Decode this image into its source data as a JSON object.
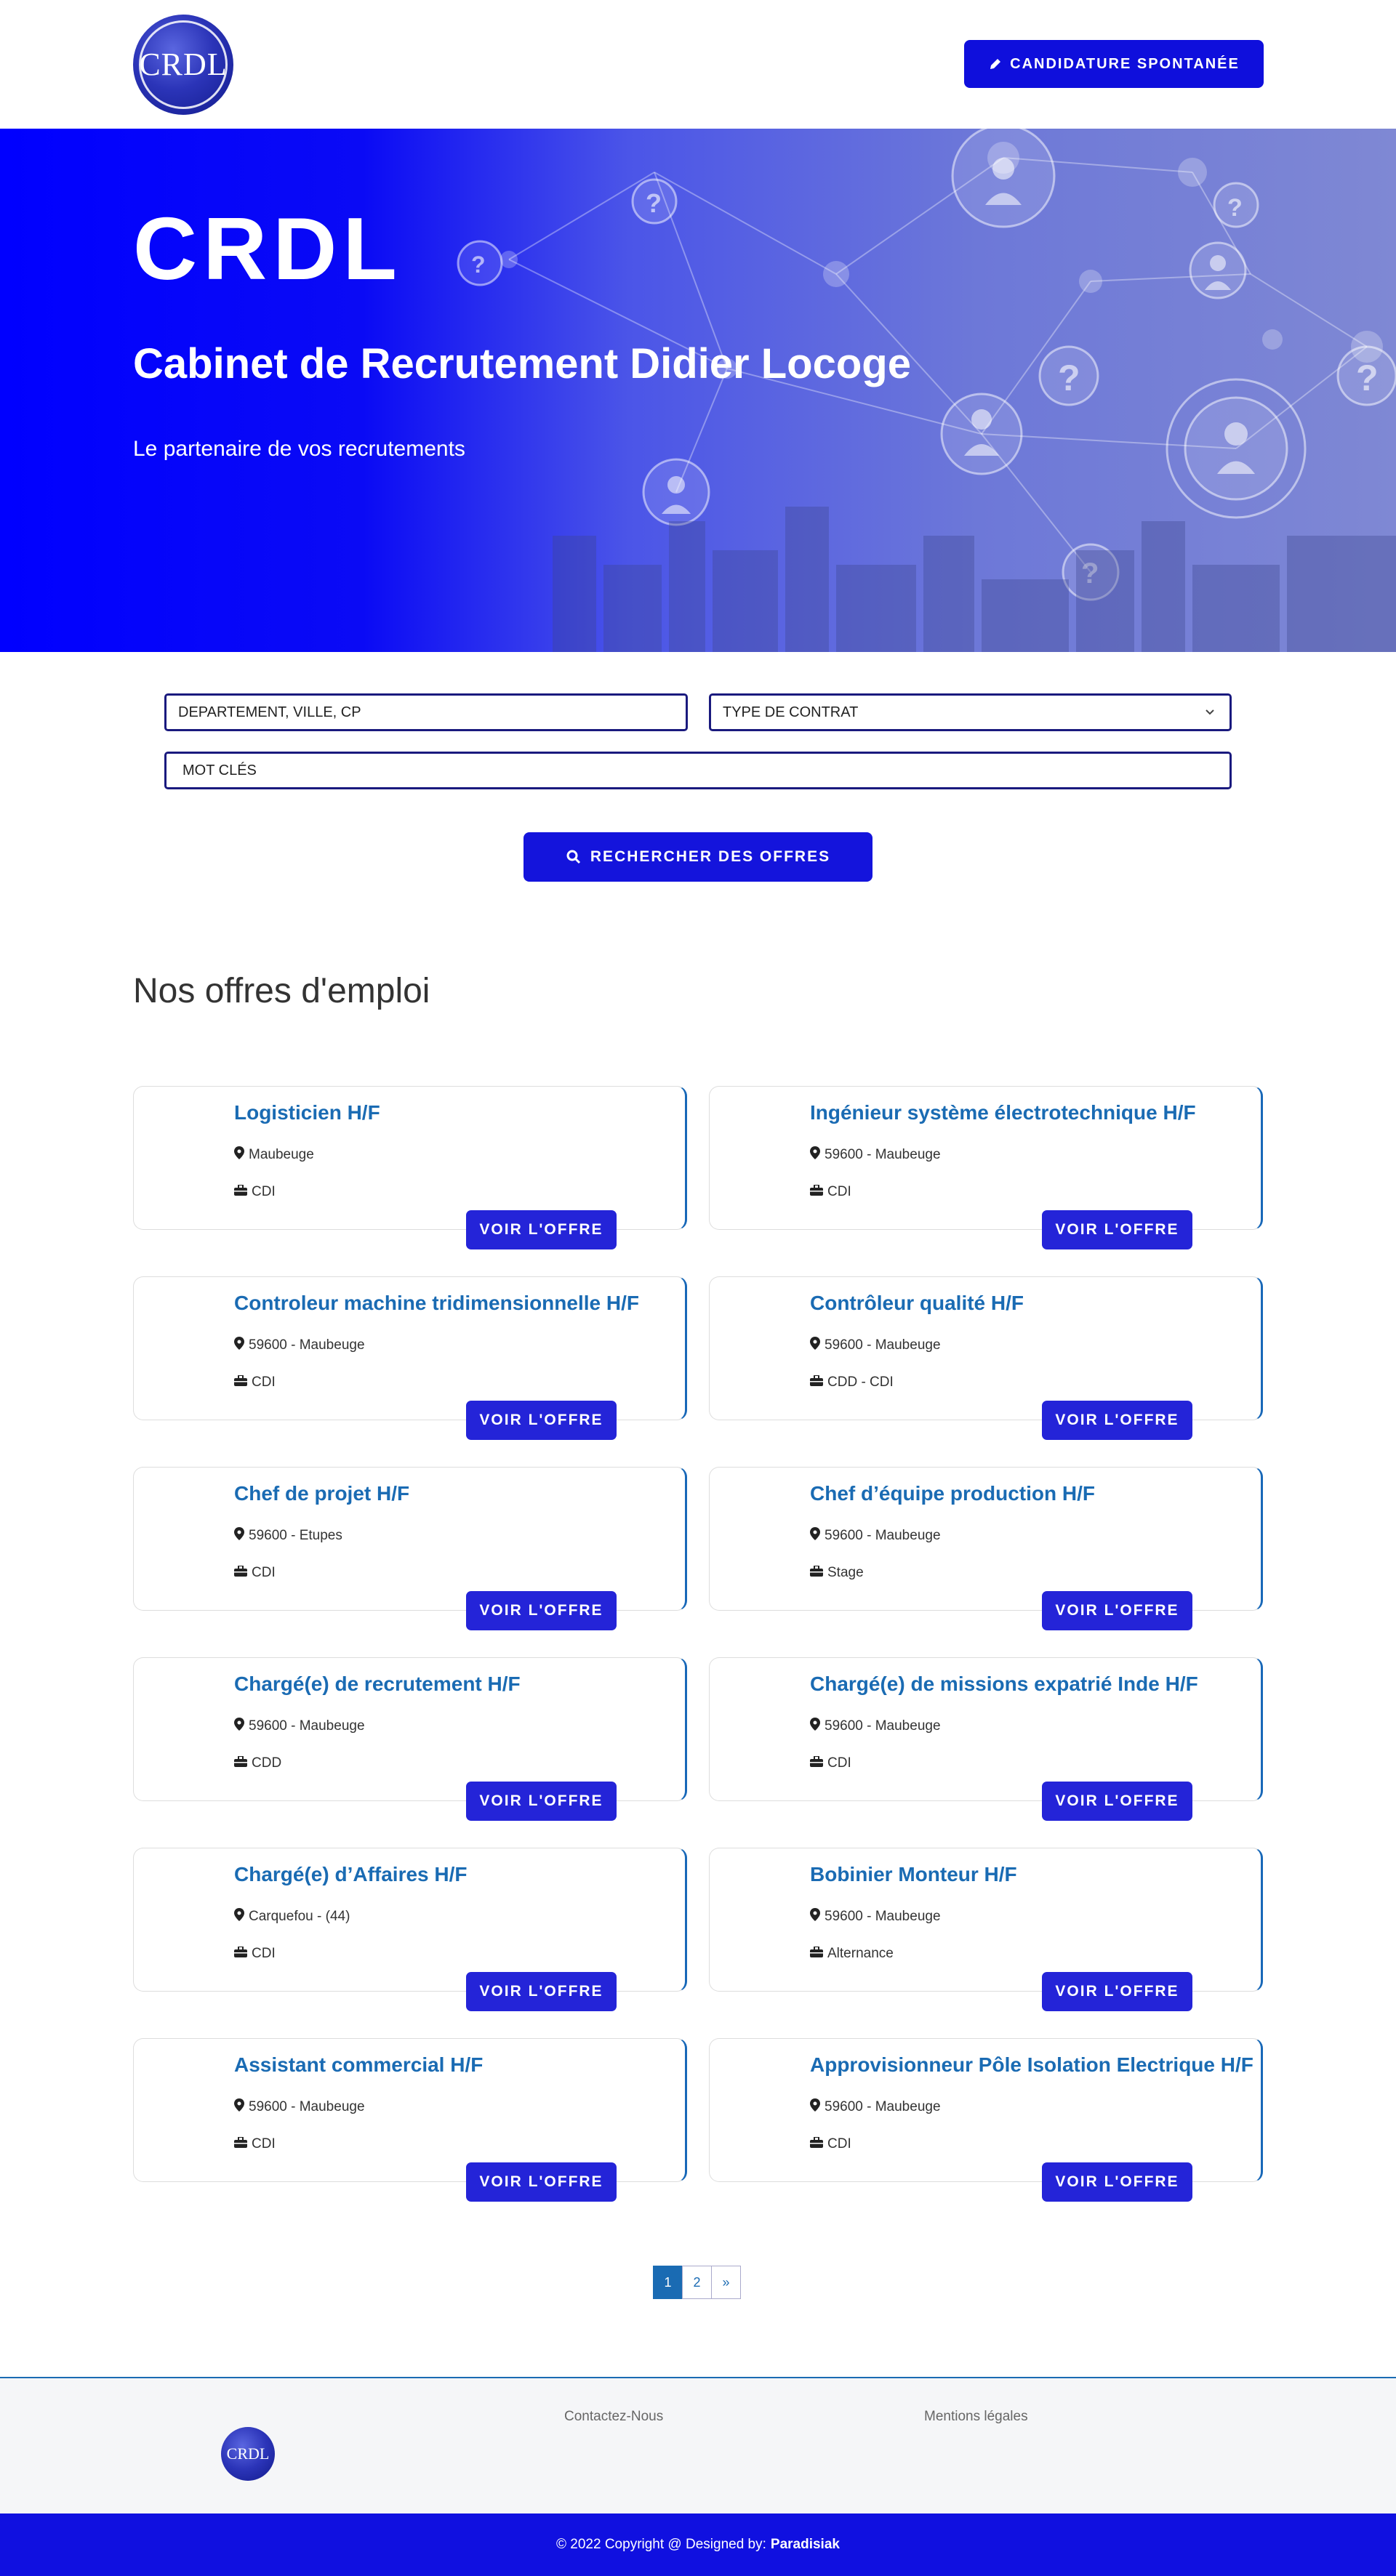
{
  "header": {
    "logo_text": "CRDL",
    "spontaneous_button": "CANDIDATURE SPONTANÉE"
  },
  "hero": {
    "title": "CRDL",
    "subtitle": "Cabinet de Recrutement Didier Locoge",
    "tagline": "Le partenaire de vos recrutements"
  },
  "search": {
    "location_placeholder": "DEPARTEMENT, VILLE, CP",
    "contract_select": "TYPE DE CONTRAT",
    "keywords_placeholder": "MOT CLÉS",
    "search_button": "RECHERCHER DES OFFRES"
  },
  "jobs_section": {
    "title": "Nos offres d'emploi",
    "view_label": "VOIR L'OFFRE",
    "jobs": [
      {
        "title": "Logisticien H/F",
        "location": "Maubeuge",
        "contract": "CDI"
      },
      {
        "title": "Ingénieur système électrotechnique  H/F",
        "location": "59600 - Maubeuge",
        "contract": "CDI"
      },
      {
        "title": "Controleur machine tridimensionnelle H/F",
        "location": "59600 - Maubeuge",
        "contract": "CDI"
      },
      {
        "title": "Contrôleur qualité H/F",
        "location": "59600 - Maubeuge",
        "contract": "CDD - CDI"
      },
      {
        "title": "Chef de projet H/F",
        "location": "59600 - Etupes",
        "contract": "CDI"
      },
      {
        "title": "Chef d’équipe production H/F",
        "location": "59600 - Maubeuge",
        "contract": "Stage"
      },
      {
        "title": "Chargé(e) de recrutement  H/F",
        "location": "59600 - Maubeuge",
        "contract": "CDD"
      },
      {
        "title": "Chargé(e) de missions expatrié Inde H/F",
        "location": "59600 - Maubeuge",
        "contract": "CDI"
      },
      {
        "title": "Chargé(e) d’Affaires H/F",
        "location": "Carquefou - (44)",
        "contract": "CDI"
      },
      {
        "title": "Bobinier Monteur H/F",
        "location": "59600 - Maubeuge",
        "contract": "Alternance"
      },
      {
        "title": "Assistant commercial H/F",
        "location": "59600 - Maubeuge",
        "contract": "CDI"
      },
      {
        "title": "Approvisionneur Pôle Isolation Electrique H/F",
        "location": "59600 - Maubeuge",
        "contract": "CDI"
      }
    ]
  },
  "pagination": {
    "pages": [
      "1",
      "2",
      "»"
    ],
    "current": "1"
  },
  "footer": {
    "logo_text": "CRDL",
    "contact_link": "Contactez-Nous",
    "legal_link": "Mentions légales",
    "copyright": "© 2022 Copyright @ Designed by:",
    "designer": "Paradisiak"
  },
  "colors": {
    "brand_blue": "#0f0fdc",
    "link_blue": "#1a6bb3"
  }
}
